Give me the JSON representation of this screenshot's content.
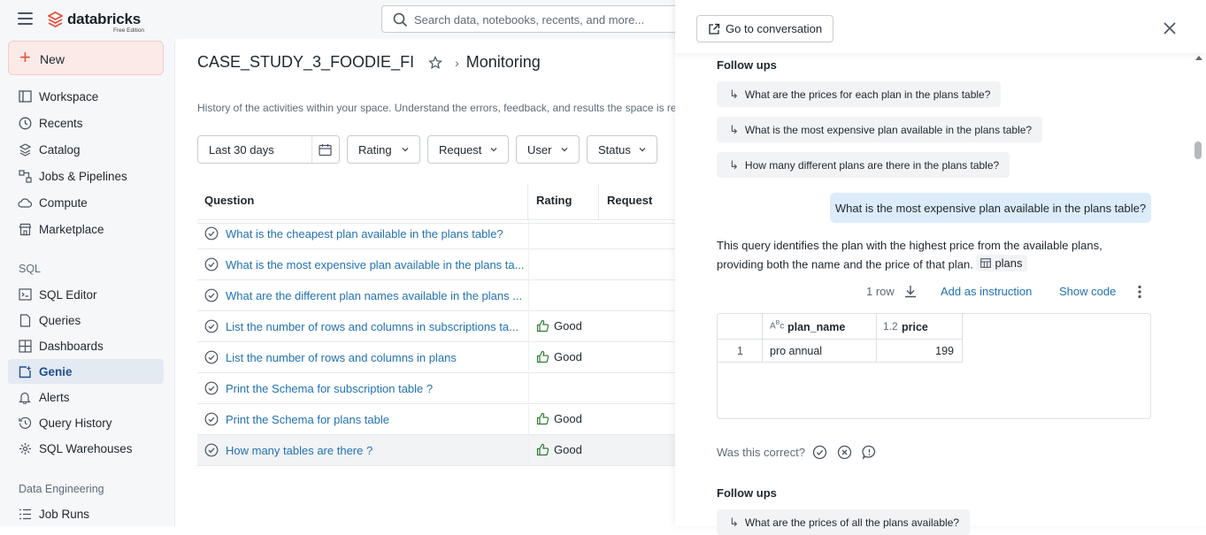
{
  "app": {
    "brand": "databricks",
    "edition": "Free Edition",
    "search_placeholder": "Search data, notebooks, recents, and more..."
  },
  "sidebar": {
    "new_label": "New",
    "items": [
      {
        "label": "Workspace",
        "icon": "workspace-icon"
      },
      {
        "label": "Recents",
        "icon": "clock-icon"
      },
      {
        "label": "Catalog",
        "icon": "catalog-icon"
      },
      {
        "label": "Jobs & Pipelines",
        "icon": "jobs-icon"
      },
      {
        "label": "Compute",
        "icon": "cloud-icon"
      },
      {
        "label": "Marketplace",
        "icon": "store-icon"
      }
    ],
    "sql_section": "SQL",
    "sql_items": [
      {
        "label": "SQL Editor",
        "icon": "editor-icon"
      },
      {
        "label": "Queries",
        "icon": "queries-icon"
      },
      {
        "label": "Dashboards",
        "icon": "dashboard-icon"
      },
      {
        "label": "Genie",
        "icon": "genie-icon",
        "active": true
      },
      {
        "label": "Alerts",
        "icon": "bell-icon"
      },
      {
        "label": "Query History",
        "icon": "history-icon"
      },
      {
        "label": "SQL Warehouses",
        "icon": "warehouse-icon"
      }
    ],
    "de_section": "Data Engineering",
    "de_items": [
      {
        "label": "Job Runs",
        "icon": "job-runs-icon"
      }
    ]
  },
  "main": {
    "space_name": "CASE_STUDY_3_FOODIE_FI",
    "page_title": "Monitoring",
    "description": "History of the activities within your space. Understand the errors, feedback, and results the space is retu",
    "filters": {
      "date": "Last 30 days",
      "rating": "Rating",
      "request": "Request",
      "user": "User",
      "status": "Status"
    },
    "columns": {
      "question": "Question",
      "rating": "Rating",
      "request": "Request"
    },
    "rows": [
      {
        "question": "What is the cheapest plan available in the plans table?",
        "rating": ""
      },
      {
        "question": "What is the most expensive plan available in the plans ta...",
        "rating": ""
      },
      {
        "question": "What are the different plan names available in the plans ...",
        "rating": ""
      },
      {
        "question": "List the number of rows and columns in subscriptions ta...",
        "rating": "Good"
      },
      {
        "question": "List the number of rows and columns in plans",
        "rating": "Good"
      },
      {
        "question": "Print the Schema for subscription table ?",
        "rating": ""
      },
      {
        "question": "Print the Schema for plans table",
        "rating": "Good"
      },
      {
        "question": "How many tables are there ?",
        "rating": "Good"
      }
    ]
  },
  "panel": {
    "go_to_conversation": "Go to conversation",
    "follow_ups_title": "Follow ups",
    "follow_ups": [
      "What are the prices for each plan in the plans table?",
      "What is the most expensive plan available in the plans table?",
      "How many different plans are there in the plans table?"
    ],
    "user_message": "What is the most expensive plan available in the plans table?",
    "answer_text": "This query identifies the plan with the highest price from the available plans, providing both the name and the price of that plan.",
    "table_ref": "plans",
    "row_count": "1 row",
    "add_instruction": "Add as instruction",
    "show_code": "Show code",
    "result": {
      "col1_type": "ABC",
      "col1": "plan_name",
      "col2_type": "1.2",
      "col2": "price",
      "row_index": "1",
      "plan_name": "pro annual",
      "price": "199"
    },
    "feedback_prompt": "Was this correct?",
    "follow_ups_title_2": "Follow ups",
    "follow_ups_2": [
      "What are the prices of all the plans available?"
    ]
  },
  "colors": {
    "accent": "#2272b4",
    "brand": "#e0533c",
    "active_nav_bg": "#e4eaf1",
    "user_bubble": "#dcecfb",
    "good": "#2e7d32"
  }
}
